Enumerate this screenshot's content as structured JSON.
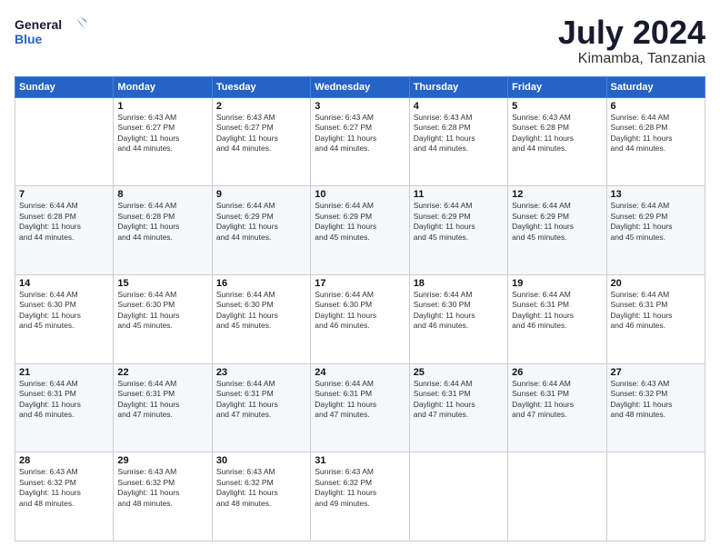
{
  "logo": {
    "text_general": "General",
    "text_blue": "Blue"
  },
  "title": "July 2024",
  "location": "Kimamba, Tanzania",
  "weekdays": [
    "Sunday",
    "Monday",
    "Tuesday",
    "Wednesday",
    "Thursday",
    "Friday",
    "Saturday"
  ],
  "weeks": [
    [
      {
        "day": "",
        "info": ""
      },
      {
        "day": "1",
        "info": "Sunrise: 6:43 AM\nSunset: 6:27 PM\nDaylight: 11 hours\nand 44 minutes."
      },
      {
        "day": "2",
        "info": "Sunrise: 6:43 AM\nSunset: 6:27 PM\nDaylight: 11 hours\nand 44 minutes."
      },
      {
        "day": "3",
        "info": "Sunrise: 6:43 AM\nSunset: 6:27 PM\nDaylight: 11 hours\nand 44 minutes."
      },
      {
        "day": "4",
        "info": "Sunrise: 6:43 AM\nSunset: 6:28 PM\nDaylight: 11 hours\nand 44 minutes."
      },
      {
        "day": "5",
        "info": "Sunrise: 6:43 AM\nSunset: 6:28 PM\nDaylight: 11 hours\nand 44 minutes."
      },
      {
        "day": "6",
        "info": "Sunrise: 6:44 AM\nSunset: 6:28 PM\nDaylight: 11 hours\nand 44 minutes."
      }
    ],
    [
      {
        "day": "7",
        "info": "Sunrise: 6:44 AM\nSunset: 6:28 PM\nDaylight: 11 hours\nand 44 minutes."
      },
      {
        "day": "8",
        "info": "Sunrise: 6:44 AM\nSunset: 6:28 PM\nDaylight: 11 hours\nand 44 minutes."
      },
      {
        "day": "9",
        "info": "Sunrise: 6:44 AM\nSunset: 6:29 PM\nDaylight: 11 hours\nand 44 minutes."
      },
      {
        "day": "10",
        "info": "Sunrise: 6:44 AM\nSunset: 6:29 PM\nDaylight: 11 hours\nand 45 minutes."
      },
      {
        "day": "11",
        "info": "Sunrise: 6:44 AM\nSunset: 6:29 PM\nDaylight: 11 hours\nand 45 minutes."
      },
      {
        "day": "12",
        "info": "Sunrise: 6:44 AM\nSunset: 6:29 PM\nDaylight: 11 hours\nand 45 minutes."
      },
      {
        "day": "13",
        "info": "Sunrise: 6:44 AM\nSunset: 6:29 PM\nDaylight: 11 hours\nand 45 minutes."
      }
    ],
    [
      {
        "day": "14",
        "info": "Sunrise: 6:44 AM\nSunset: 6:30 PM\nDaylight: 11 hours\nand 45 minutes."
      },
      {
        "day": "15",
        "info": "Sunrise: 6:44 AM\nSunset: 6:30 PM\nDaylight: 11 hours\nand 45 minutes."
      },
      {
        "day": "16",
        "info": "Sunrise: 6:44 AM\nSunset: 6:30 PM\nDaylight: 11 hours\nand 45 minutes."
      },
      {
        "day": "17",
        "info": "Sunrise: 6:44 AM\nSunset: 6:30 PM\nDaylight: 11 hours\nand 46 minutes."
      },
      {
        "day": "18",
        "info": "Sunrise: 6:44 AM\nSunset: 6:30 PM\nDaylight: 11 hours\nand 46 minutes."
      },
      {
        "day": "19",
        "info": "Sunrise: 6:44 AM\nSunset: 6:31 PM\nDaylight: 11 hours\nand 46 minutes."
      },
      {
        "day": "20",
        "info": "Sunrise: 6:44 AM\nSunset: 6:31 PM\nDaylight: 11 hours\nand 46 minutes."
      }
    ],
    [
      {
        "day": "21",
        "info": "Sunrise: 6:44 AM\nSunset: 6:31 PM\nDaylight: 11 hours\nand 46 minutes."
      },
      {
        "day": "22",
        "info": "Sunrise: 6:44 AM\nSunset: 6:31 PM\nDaylight: 11 hours\nand 47 minutes."
      },
      {
        "day": "23",
        "info": "Sunrise: 6:44 AM\nSunset: 6:31 PM\nDaylight: 11 hours\nand 47 minutes."
      },
      {
        "day": "24",
        "info": "Sunrise: 6:44 AM\nSunset: 6:31 PM\nDaylight: 11 hours\nand 47 minutes."
      },
      {
        "day": "25",
        "info": "Sunrise: 6:44 AM\nSunset: 6:31 PM\nDaylight: 11 hours\nand 47 minutes."
      },
      {
        "day": "26",
        "info": "Sunrise: 6:44 AM\nSunset: 6:31 PM\nDaylight: 11 hours\nand 47 minutes."
      },
      {
        "day": "27",
        "info": "Sunrise: 6:43 AM\nSunset: 6:32 PM\nDaylight: 11 hours\nand 48 minutes."
      }
    ],
    [
      {
        "day": "28",
        "info": "Sunrise: 6:43 AM\nSunset: 6:32 PM\nDaylight: 11 hours\nand 48 minutes."
      },
      {
        "day": "29",
        "info": "Sunrise: 6:43 AM\nSunset: 6:32 PM\nDaylight: 11 hours\nand 48 minutes."
      },
      {
        "day": "30",
        "info": "Sunrise: 6:43 AM\nSunset: 6:32 PM\nDaylight: 11 hours\nand 48 minutes."
      },
      {
        "day": "31",
        "info": "Sunrise: 6:43 AM\nSunset: 6:32 PM\nDaylight: 11 hours\nand 49 minutes."
      },
      {
        "day": "",
        "info": ""
      },
      {
        "day": "",
        "info": ""
      },
      {
        "day": "",
        "info": ""
      }
    ]
  ]
}
